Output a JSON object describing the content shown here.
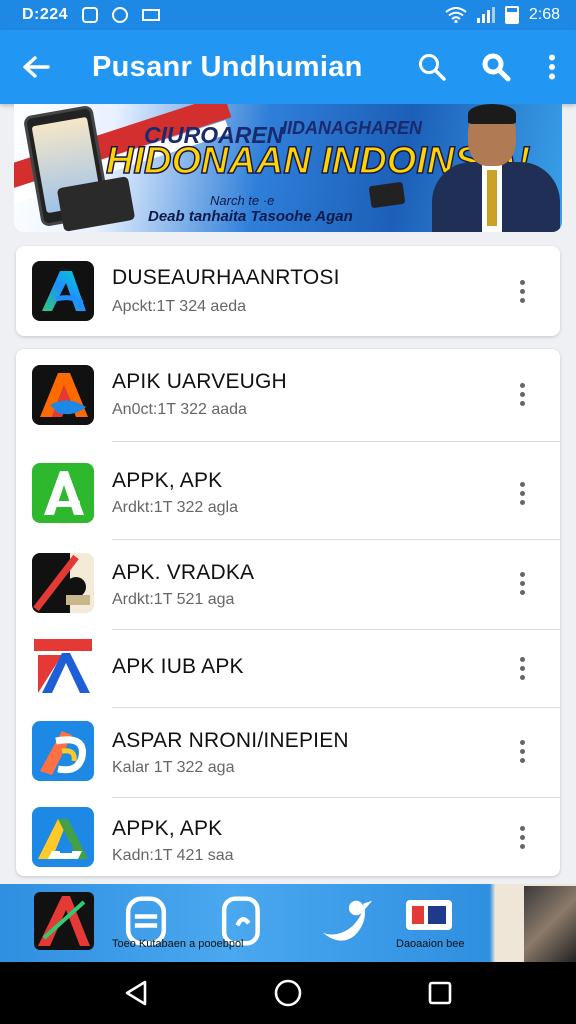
{
  "status_bar": {
    "time": "D:224",
    "right_text": "2:68"
  },
  "app_bar": {
    "title": "Pusanr Undhumian",
    "back_icon": "back-arrow-icon",
    "actions": [
      "search-icon",
      "search-bold-icon",
      "more-vert-icon"
    ]
  },
  "banner": {
    "headline_small_1": "CIUROAREN",
    "headline_small_2": "IIDANAGHAREN",
    "headline_large": "HIDONAAN INDOINSIA!",
    "sub_1": "Narch te ·e",
    "sub_2": "Deab tanhaita Tasoohe Agan"
  },
  "featured": {
    "name": "DUSEAURHAANRTOSI",
    "meta": "Apckt:1T 324 aeda"
  },
  "apps": [
    {
      "name": "APIK UARVEUGH",
      "meta": "An0ct:1T 322 aada",
      "icon": "apk-blue-a-icon"
    },
    {
      "name": "APPK, APK",
      "meta": "Ardkt:1T 322 agla",
      "icon": "apk-green-a-icon"
    },
    {
      "name": "APK. VRADKA",
      "meta": "Ardkt:1T 521 aga",
      "icon": "apk-dark-slash-icon"
    },
    {
      "name": "APK IUB APK",
      "meta": "",
      "icon": "apk-red-blue-a-icon"
    },
    {
      "name": "ASPAR NRONI/INEPIEN",
      "meta": "Kalar 1T 322 aga",
      "icon": "apk-multicolor-icon"
    },
    {
      "name": "APPK, APK",
      "meta": "Kadn:1T 421 saa",
      "icon": "apk-google-drive-style-icon"
    }
  ],
  "bottom_strip": {
    "caption_left": "Toeo Kutabaen a pooebpol",
    "caption_right": "Daoaaion bee"
  },
  "colors": {
    "status_bar": "#1e88e5",
    "app_bar": "#2196f3",
    "background": "#eef0f3"
  }
}
